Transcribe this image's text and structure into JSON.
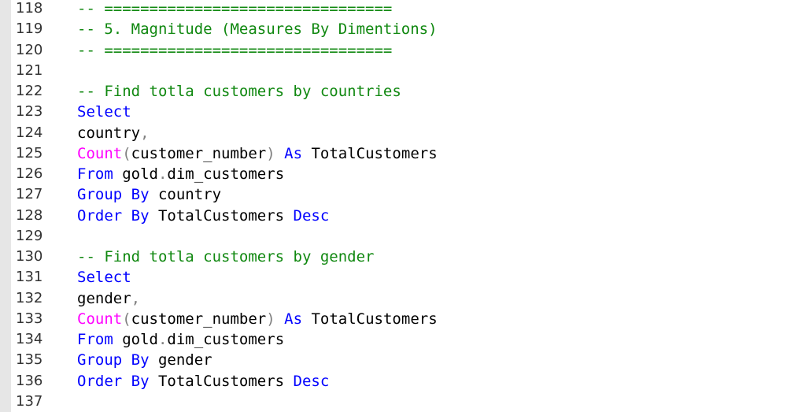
{
  "editor": {
    "lines": [
      {
        "number": "118",
        "tokens": [
          {
            "t": "comment",
            "v": "-- ================================"
          }
        ]
      },
      {
        "number": "119",
        "tokens": [
          {
            "t": "comment",
            "v": "-- 5. Magnitude (Measures By Dimentions)"
          }
        ]
      },
      {
        "number": "120",
        "tokens": [
          {
            "t": "comment",
            "v": "-- ================================"
          }
        ]
      },
      {
        "number": "121",
        "tokens": []
      },
      {
        "number": "122",
        "tokens": [
          {
            "t": "comment",
            "v": "-- Find totla customers by countries"
          }
        ]
      },
      {
        "number": "123",
        "tokens": [
          {
            "t": "kw",
            "v": "Select"
          }
        ]
      },
      {
        "number": "124",
        "tokens": [
          {
            "t": "plain",
            "v": "country"
          },
          {
            "t": "op",
            "v": ","
          }
        ]
      },
      {
        "number": "125",
        "tokens": [
          {
            "t": "fn",
            "v": "Count"
          },
          {
            "t": "op",
            "v": "("
          },
          {
            "t": "plain",
            "v": "customer_number"
          },
          {
            "t": "op",
            "v": ")"
          },
          {
            "t": "plain",
            "v": " "
          },
          {
            "t": "kw",
            "v": "As"
          },
          {
            "t": "plain",
            "v": " TotalCustomers"
          }
        ]
      },
      {
        "number": "126",
        "tokens": [
          {
            "t": "kw",
            "v": "From"
          },
          {
            "t": "plain",
            "v": " gold"
          },
          {
            "t": "op",
            "v": "."
          },
          {
            "t": "plain",
            "v": "dim_customers"
          }
        ]
      },
      {
        "number": "127",
        "tokens": [
          {
            "t": "kw",
            "v": "Group By"
          },
          {
            "t": "plain",
            "v": " country"
          }
        ]
      },
      {
        "number": "128",
        "tokens": [
          {
            "t": "kw",
            "v": "Order By"
          },
          {
            "t": "plain",
            "v": " TotalCustomers "
          },
          {
            "t": "kw",
            "v": "Desc"
          }
        ]
      },
      {
        "number": "129",
        "tokens": []
      },
      {
        "number": "130",
        "tokens": [
          {
            "t": "comment",
            "v": "-- Find totla customers by gender"
          }
        ]
      },
      {
        "number": "131",
        "tokens": [
          {
            "t": "kw",
            "v": "Select"
          }
        ]
      },
      {
        "number": "132",
        "tokens": [
          {
            "t": "plain",
            "v": "gender"
          },
          {
            "t": "op",
            "v": ","
          }
        ]
      },
      {
        "number": "133",
        "tokens": [
          {
            "t": "fn",
            "v": "Count"
          },
          {
            "t": "op",
            "v": "("
          },
          {
            "t": "plain",
            "v": "customer_number"
          },
          {
            "t": "op",
            "v": ")"
          },
          {
            "t": "plain",
            "v": " "
          },
          {
            "t": "kw",
            "v": "As"
          },
          {
            "t": "plain",
            "v": " TotalCustomers"
          }
        ]
      },
      {
        "number": "134",
        "tokens": [
          {
            "t": "kw",
            "v": "From"
          },
          {
            "t": "plain",
            "v": " gold"
          },
          {
            "t": "op",
            "v": "."
          },
          {
            "t": "plain",
            "v": "dim_customers"
          }
        ]
      },
      {
        "number": "135",
        "tokens": [
          {
            "t": "kw",
            "v": "Group By"
          },
          {
            "t": "plain",
            "v": " gender"
          }
        ]
      },
      {
        "number": "136",
        "tokens": [
          {
            "t": "kw",
            "v": "Order By"
          },
          {
            "t": "plain",
            "v": " TotalCustomers "
          },
          {
            "t": "kw",
            "v": "Desc"
          }
        ]
      },
      {
        "number": "137",
        "tokens": []
      }
    ],
    "colors": {
      "comment": "#108810",
      "keyword": "#0000ff",
      "function": "#ff00ff",
      "operator": "#808080",
      "text": "#000000",
      "gutter": "#e6e6e6"
    }
  }
}
